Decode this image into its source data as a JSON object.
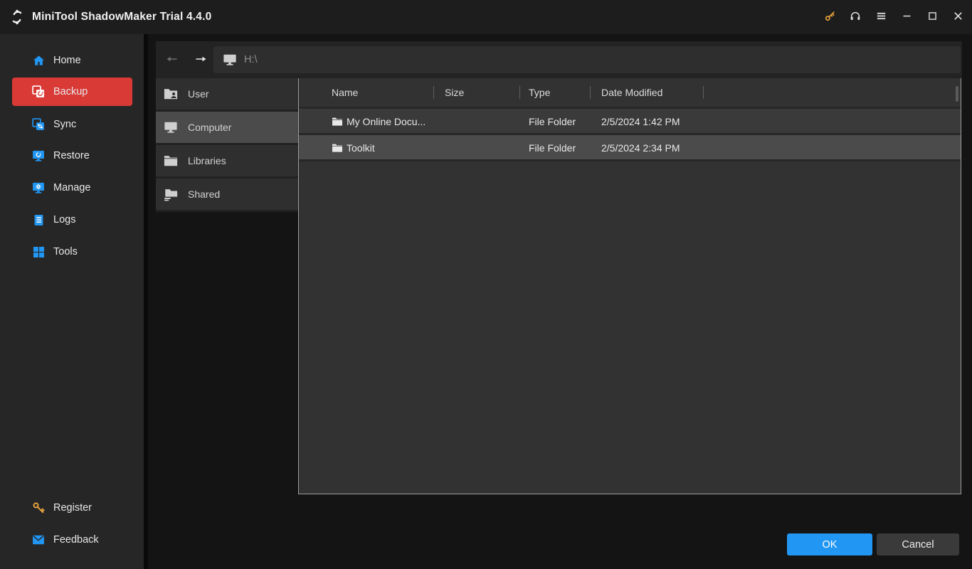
{
  "window": {
    "title": "MiniTool ShadowMaker Trial 4.4.0"
  },
  "title_bar": {
    "icons": [
      "license-key-icon",
      "headset-icon",
      "menu-icon",
      "minimize-icon",
      "maximize-icon",
      "close-icon"
    ]
  },
  "sidebar": {
    "items": [
      {
        "label": "Home",
        "icon": "home-icon",
        "selected": false
      },
      {
        "label": "Backup",
        "icon": "backup-icon",
        "selected": true
      },
      {
        "label": "Sync",
        "icon": "sync-icon",
        "selected": false
      },
      {
        "label": "Restore",
        "icon": "restore-icon",
        "selected": false
      },
      {
        "label": "Manage",
        "icon": "manage-icon",
        "selected": false
      },
      {
        "label": "Logs",
        "icon": "logs-icon",
        "selected": false
      },
      {
        "label": "Tools",
        "icon": "tools-icon",
        "selected": false
      }
    ],
    "bottom_items": [
      {
        "label": "Register",
        "icon": "key-icon"
      },
      {
        "label": "Feedback",
        "icon": "envelope-icon"
      }
    ]
  },
  "nav": {
    "path": "H:\\"
  },
  "places": {
    "items": [
      {
        "label": "User",
        "icon": "user-folder-icon",
        "selected": false
      },
      {
        "label": "Computer",
        "icon": "computer-icon",
        "selected": true
      },
      {
        "label": "Libraries",
        "icon": "folder-icon",
        "selected": false
      },
      {
        "label": "Shared",
        "icon": "shared-folder-icon",
        "selected": false
      }
    ]
  },
  "file_list": {
    "columns": [
      "Name",
      "Size",
      "Type",
      "Date Modified"
    ],
    "rows": [
      {
        "name": "My Online Docu...",
        "size": "",
        "type": "File Folder",
        "date_modified": "2/5/2024 1:42 PM",
        "selected": false
      },
      {
        "name": "Toolkit",
        "size": "",
        "type": "File Folder",
        "date_modified": "2/5/2024 2:34 PM",
        "selected": true
      }
    ]
  },
  "footer": {
    "ok": "OK",
    "cancel": "Cancel"
  },
  "colors": {
    "accent_red": "#d93a36",
    "accent_blue": "#2196f3",
    "gold_key": "#e8a33d",
    "titlebar_bg": "#1d1d1d",
    "sidebar_bg": "#262626",
    "panel_bg": "#323232",
    "selected_row_bg": "#4b4b4b",
    "panel_border": "#9c9c9c"
  }
}
